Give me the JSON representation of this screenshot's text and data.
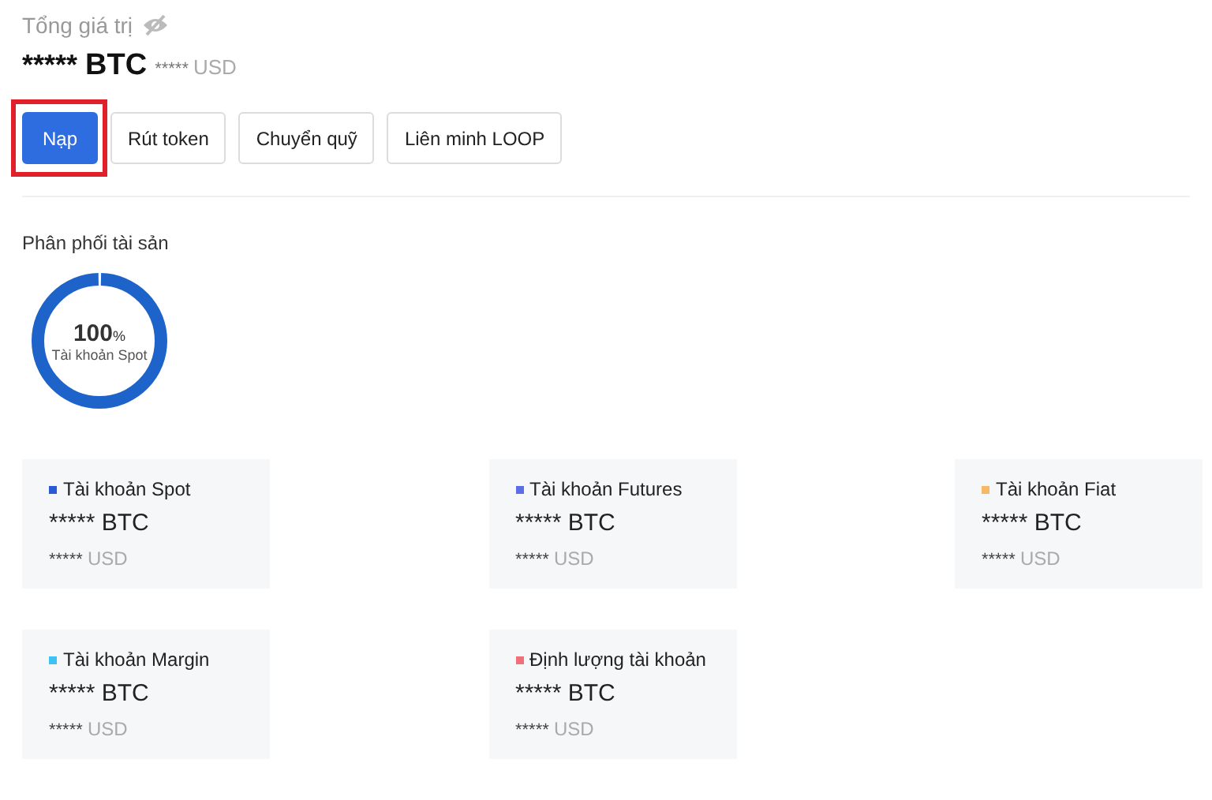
{
  "total": {
    "label": "Tổng giá trị",
    "btc_amount": "*****",
    "btc_unit": "BTC",
    "usd_amount": "*****",
    "usd_unit": "USD"
  },
  "actions": [
    {
      "label": "Nạp",
      "kind": "primary",
      "highlighted": true
    },
    {
      "label": "Rút token",
      "kind": "default",
      "highlighted": false
    },
    {
      "label": "Chuyển quỹ",
      "kind": "default",
      "highlighted": false
    },
    {
      "label": "Liên minh LOOP",
      "kind": "default",
      "highlighted": false
    }
  ],
  "distribution": {
    "title": "Phân phối tài sản",
    "center_value": "100",
    "center_unit": "%",
    "center_label": "Tài khoản Spot"
  },
  "accounts": [
    {
      "name": "Tài khoản Spot",
      "color": "#2a5bd7",
      "btc_amount": "*****",
      "btc_unit": "BTC",
      "usd_amount": "*****",
      "usd_unit": "USD"
    },
    {
      "name": "Tài khoản Futures",
      "color": "#5b6ee8",
      "btc_amount": "*****",
      "btc_unit": "BTC",
      "usd_amount": "*****",
      "usd_unit": "USD"
    },
    {
      "name": "Tài khoản Fiat",
      "color": "#f7b868",
      "btc_amount": "*****",
      "btc_unit": "BTC",
      "usd_amount": "*****",
      "usd_unit": "USD"
    },
    {
      "name": "Tài khoản Margin",
      "color": "#3ec1f3",
      "btc_amount": "*****",
      "btc_unit": "BTC",
      "usd_amount": "*****",
      "usd_unit": "USD"
    },
    {
      "name": "Định lượng tài khoản",
      "color": "#f0707a",
      "btc_amount": "*****",
      "btc_unit": "BTC",
      "usd_amount": "*****",
      "usd_unit": "USD"
    }
  ]
}
